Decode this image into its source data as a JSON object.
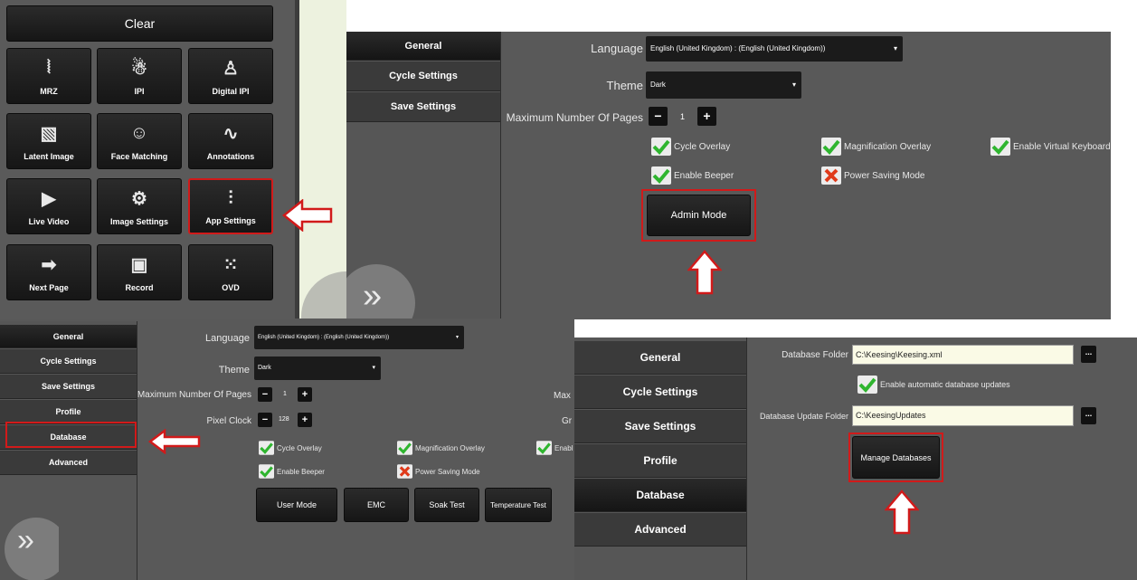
{
  "tiles": {
    "clear": "Clear",
    "items": [
      {
        "label": "MRZ",
        "icon": "mrz-icon",
        "glyph": "⦚"
      },
      {
        "label": "IPI",
        "icon": "ipi-icon",
        "glyph": "☃"
      },
      {
        "label": "Digital IPI",
        "icon": "digital-ipi-icon",
        "glyph": "♙"
      },
      {
        "label": "Latent Image",
        "icon": "latent-image-icon",
        "glyph": "▧"
      },
      {
        "label": "Face Matching",
        "icon": "face-matching-icon",
        "glyph": "☺"
      },
      {
        "label": "Annotations",
        "icon": "annotations-icon",
        "glyph": "∿"
      },
      {
        "label": "Live Video",
        "icon": "play-icon",
        "glyph": "▶"
      },
      {
        "label": "Image Settings",
        "icon": "image-settings-icon",
        "glyph": "⚙"
      },
      {
        "label": "App Settings",
        "icon": "sliders-icon",
        "glyph": "⫶"
      },
      {
        "label": "Next Page",
        "icon": "arrow-right-icon",
        "glyph": "➡"
      },
      {
        "label": "Record",
        "icon": "save-icon",
        "glyph": "▣"
      },
      {
        "label": "OVD",
        "icon": "ovd-icon",
        "glyph": "⁙"
      }
    ]
  },
  "settings_top": {
    "nav": [
      "General",
      "Cycle Settings",
      "Save Settings"
    ],
    "language_label": "Language",
    "language_value": "English (United Kingdom) :  (English (United Kingdom))",
    "theme_label": "Theme",
    "theme_value": "Dark",
    "max_pages_label": "Maximum Number Of Pages",
    "max_pages_value": "1",
    "checks": {
      "cycle_overlay": "Cycle Overlay",
      "magnification_overlay": "Magnification Overlay",
      "virtual_keyboard": "Enable Virtual Keyboard",
      "enable_beeper": "Enable Beeper",
      "power_saving": "Power Saving Mode"
    },
    "admin_mode": "Admin Mode"
  },
  "settings_admin": {
    "nav": [
      "General",
      "Cycle Settings",
      "Save Settings",
      "Profile",
      "Database",
      "Advanced"
    ],
    "language_label": "Language",
    "language_value": "English (United Kingdom) :  (English (United Kingdom))",
    "theme_label": "Theme",
    "theme_value": "Dark",
    "max_pages_label": "Maximum Number Of Pages",
    "max_pages_value": "1",
    "pixel_clock_label": "Pixel Clock",
    "pixel_clock_value": "128",
    "cut_right_1": "Max",
    "cut_right_2": "Gr",
    "checks": {
      "cycle_overlay": "Cycle Overlay",
      "magnification_overlay": "Magnification Overlay",
      "enable_cut": "Enabl",
      "enable_beeper": "Enable Beeper",
      "power_saving": "Power Saving Mode"
    },
    "buttons": [
      "User Mode",
      "EMC",
      "Soak Test",
      "Temperature Test"
    ]
  },
  "settings_db": {
    "nav": [
      "General",
      "Cycle Settings",
      "Save Settings",
      "Profile",
      "Database",
      "Advanced"
    ],
    "db_folder_label": "Database Folder",
    "db_folder_value": "C:\\Keesing\\Keesing.xml",
    "auto_updates": "Enable automatic database updates",
    "update_folder_label": "Database Update Folder",
    "update_folder_value": "C:\\KeesingUpdates",
    "browse": "...",
    "manage": "Manage Databases"
  },
  "colors": {
    "panel": "#595959",
    "highlight": "#d11a1a",
    "check": "#2fb52f"
  }
}
